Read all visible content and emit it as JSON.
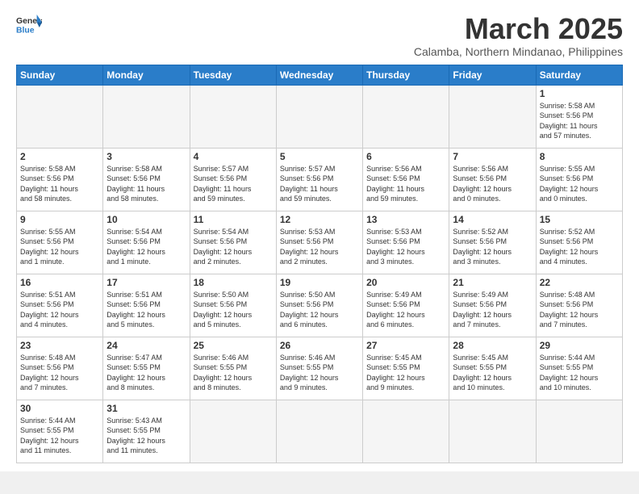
{
  "header": {
    "logo_general": "General",
    "logo_blue": "Blue",
    "month_title": "March 2025",
    "subtitle": "Calamba, Northern Mindanao, Philippines"
  },
  "weekdays": [
    "Sunday",
    "Monday",
    "Tuesday",
    "Wednesday",
    "Thursday",
    "Friday",
    "Saturday"
  ],
  "weeks": [
    [
      {
        "day": "",
        "info": ""
      },
      {
        "day": "",
        "info": ""
      },
      {
        "day": "",
        "info": ""
      },
      {
        "day": "",
        "info": ""
      },
      {
        "day": "",
        "info": ""
      },
      {
        "day": "",
        "info": ""
      },
      {
        "day": "1",
        "info": "Sunrise: 5:58 AM\nSunset: 5:56 PM\nDaylight: 11 hours\nand 57 minutes."
      }
    ],
    [
      {
        "day": "2",
        "info": "Sunrise: 5:58 AM\nSunset: 5:56 PM\nDaylight: 11 hours\nand 58 minutes."
      },
      {
        "day": "3",
        "info": "Sunrise: 5:58 AM\nSunset: 5:56 PM\nDaylight: 11 hours\nand 58 minutes."
      },
      {
        "day": "4",
        "info": "Sunrise: 5:57 AM\nSunset: 5:56 PM\nDaylight: 11 hours\nand 59 minutes."
      },
      {
        "day": "5",
        "info": "Sunrise: 5:57 AM\nSunset: 5:56 PM\nDaylight: 11 hours\nand 59 minutes."
      },
      {
        "day": "6",
        "info": "Sunrise: 5:56 AM\nSunset: 5:56 PM\nDaylight: 11 hours\nand 59 minutes."
      },
      {
        "day": "7",
        "info": "Sunrise: 5:56 AM\nSunset: 5:56 PM\nDaylight: 12 hours\nand 0 minutes."
      },
      {
        "day": "8",
        "info": "Sunrise: 5:55 AM\nSunset: 5:56 PM\nDaylight: 12 hours\nand 0 minutes."
      }
    ],
    [
      {
        "day": "9",
        "info": "Sunrise: 5:55 AM\nSunset: 5:56 PM\nDaylight: 12 hours\nand 1 minute."
      },
      {
        "day": "10",
        "info": "Sunrise: 5:54 AM\nSunset: 5:56 PM\nDaylight: 12 hours\nand 1 minute."
      },
      {
        "day": "11",
        "info": "Sunrise: 5:54 AM\nSunset: 5:56 PM\nDaylight: 12 hours\nand 2 minutes."
      },
      {
        "day": "12",
        "info": "Sunrise: 5:53 AM\nSunset: 5:56 PM\nDaylight: 12 hours\nand 2 minutes."
      },
      {
        "day": "13",
        "info": "Sunrise: 5:53 AM\nSunset: 5:56 PM\nDaylight: 12 hours\nand 3 minutes."
      },
      {
        "day": "14",
        "info": "Sunrise: 5:52 AM\nSunset: 5:56 PM\nDaylight: 12 hours\nand 3 minutes."
      },
      {
        "day": "15",
        "info": "Sunrise: 5:52 AM\nSunset: 5:56 PM\nDaylight: 12 hours\nand 4 minutes."
      }
    ],
    [
      {
        "day": "16",
        "info": "Sunrise: 5:51 AM\nSunset: 5:56 PM\nDaylight: 12 hours\nand 4 minutes."
      },
      {
        "day": "17",
        "info": "Sunrise: 5:51 AM\nSunset: 5:56 PM\nDaylight: 12 hours\nand 5 minutes."
      },
      {
        "day": "18",
        "info": "Sunrise: 5:50 AM\nSunset: 5:56 PM\nDaylight: 12 hours\nand 5 minutes."
      },
      {
        "day": "19",
        "info": "Sunrise: 5:50 AM\nSunset: 5:56 PM\nDaylight: 12 hours\nand 6 minutes."
      },
      {
        "day": "20",
        "info": "Sunrise: 5:49 AM\nSunset: 5:56 PM\nDaylight: 12 hours\nand 6 minutes."
      },
      {
        "day": "21",
        "info": "Sunrise: 5:49 AM\nSunset: 5:56 PM\nDaylight: 12 hours\nand 7 minutes."
      },
      {
        "day": "22",
        "info": "Sunrise: 5:48 AM\nSunset: 5:56 PM\nDaylight: 12 hours\nand 7 minutes."
      }
    ],
    [
      {
        "day": "23",
        "info": "Sunrise: 5:48 AM\nSunset: 5:56 PM\nDaylight: 12 hours\nand 7 minutes."
      },
      {
        "day": "24",
        "info": "Sunrise: 5:47 AM\nSunset: 5:55 PM\nDaylight: 12 hours\nand 8 minutes."
      },
      {
        "day": "25",
        "info": "Sunrise: 5:46 AM\nSunset: 5:55 PM\nDaylight: 12 hours\nand 8 minutes."
      },
      {
        "day": "26",
        "info": "Sunrise: 5:46 AM\nSunset: 5:55 PM\nDaylight: 12 hours\nand 9 minutes."
      },
      {
        "day": "27",
        "info": "Sunrise: 5:45 AM\nSunset: 5:55 PM\nDaylight: 12 hours\nand 9 minutes."
      },
      {
        "day": "28",
        "info": "Sunrise: 5:45 AM\nSunset: 5:55 PM\nDaylight: 12 hours\nand 10 minutes."
      },
      {
        "day": "29",
        "info": "Sunrise: 5:44 AM\nSunset: 5:55 PM\nDaylight: 12 hours\nand 10 minutes."
      }
    ],
    [
      {
        "day": "30",
        "info": "Sunrise: 5:44 AM\nSunset: 5:55 PM\nDaylight: 12 hours\nand 11 minutes."
      },
      {
        "day": "31",
        "info": "Sunrise: 5:43 AM\nSunset: 5:55 PM\nDaylight: 12 hours\nand 11 minutes."
      },
      {
        "day": "",
        "info": ""
      },
      {
        "day": "",
        "info": ""
      },
      {
        "day": "",
        "info": ""
      },
      {
        "day": "",
        "info": ""
      },
      {
        "day": "",
        "info": ""
      }
    ]
  ]
}
